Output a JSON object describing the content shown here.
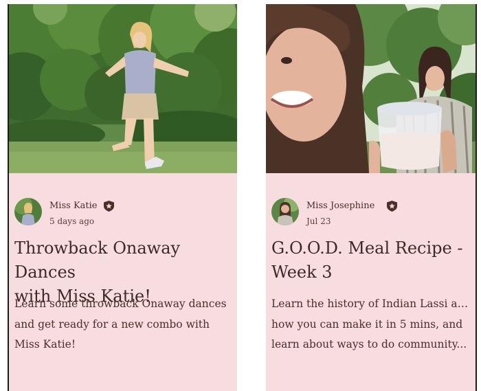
{
  "cards": [
    {
      "author": "Miss Katie",
      "date": "5 days ago",
      "title_lines": [
        "Throwback Onaway Dances",
        "with Miss Katie!"
      ],
      "desc_lines": [
        "Learn some throwback Onaway dances",
        "and get ready for a new combo with",
        "Miss Katie!"
      ]
    },
    {
      "author": "Miss Josephine",
      "date": "Jul 23",
      "title_lines": [
        "G.O.O.D. Meal Recipe -",
        "Week 3"
      ],
      "desc_lines": [
        "Learn the history of Indian Lassi and",
        "how you can make it in 5 mins, and",
        "learn about ways to do community..."
      ]
    }
  ],
  "colors": {
    "card_bg": "#f7dce0",
    "text": "#3d2a25",
    "badge": "#4a2e28"
  },
  "icons": {
    "badge": "star-badge-icon"
  }
}
